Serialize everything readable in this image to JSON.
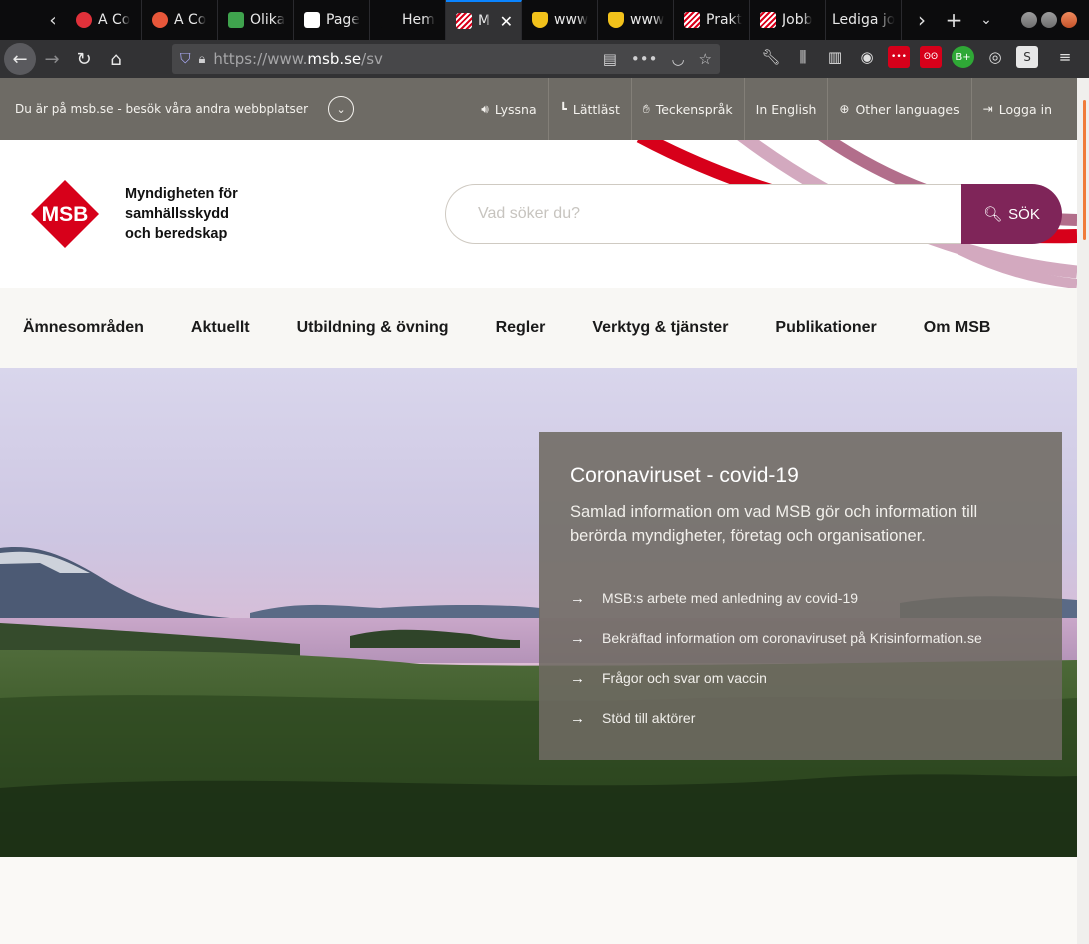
{
  "browser": {
    "tabs": [
      {
        "title": "A Co",
        "favicon_color": "#e0313a"
      },
      {
        "title": "A Co",
        "favicon_color": "#e8573a"
      },
      {
        "title": "Olika",
        "favicon_color": "#3fa34d"
      },
      {
        "title": "Page",
        "favicon_color": "#ffffff"
      },
      {
        "title": "Hem",
        "favicon_color": "#0c0c0d"
      },
      {
        "title": "M",
        "favicon_color": "#d7001a",
        "active": true
      },
      {
        "title": "www",
        "favicon_color": "#f2c21b"
      },
      {
        "title": "www",
        "favicon_color": "#f2c21b"
      },
      {
        "title": "Prakt",
        "favicon_color": "#d7001a"
      },
      {
        "title": "Jobb",
        "favicon_color": "#d7001a"
      },
      {
        "title": "Lediga jo",
        "favicon_color": "#0c0c0d"
      }
    ],
    "url_scheme": "https://www.",
    "url_host": "msb.se",
    "url_path": "/sv"
  },
  "utility": {
    "notice": "Du är på msb.se - besök våra andra webbplatser",
    "links": [
      {
        "label": "Lyssna",
        "icon": "speaker-icon"
      },
      {
        "label": "Lättläst",
        "icon": "easy-read-icon"
      },
      {
        "label": "Teckenspråk",
        "icon": "sign-language-icon"
      },
      {
        "label": "In English",
        "icon": ""
      },
      {
        "label": "Other languages",
        "icon": "globe-icon"
      },
      {
        "label": "Logga in",
        "icon": "login-icon"
      }
    ]
  },
  "header": {
    "logo_abbr": "MSB",
    "logo_line1": "Myndigheten för",
    "logo_line2": "samhällsskydd",
    "logo_line3": "och beredskap",
    "search_placeholder": "Vad söker du?",
    "search_button": "SÖK"
  },
  "mainnav": {
    "items": [
      "Ämnesområden",
      "Aktuellt",
      "Utbildning & övning",
      "Regler",
      "Verktyg & tjänster",
      "Publikationer",
      "Om MSB"
    ]
  },
  "hero": {
    "title": "Coronaviruset - covid-19",
    "lead": "Samlad information om vad MSB gör och information till berörda myndigheter, företag och organisationer.",
    "links": [
      "MSB:s arbete med anledning av covid-19",
      "Bekräftad information om coronaviruset på Krisinformation.se",
      "Frågor och svar om vaccin",
      "Stöd till aktörer"
    ]
  },
  "colors": {
    "brand_red": "#d7001a",
    "brand_purple": "#7f2559",
    "utility_bg": "#6e6b65"
  }
}
